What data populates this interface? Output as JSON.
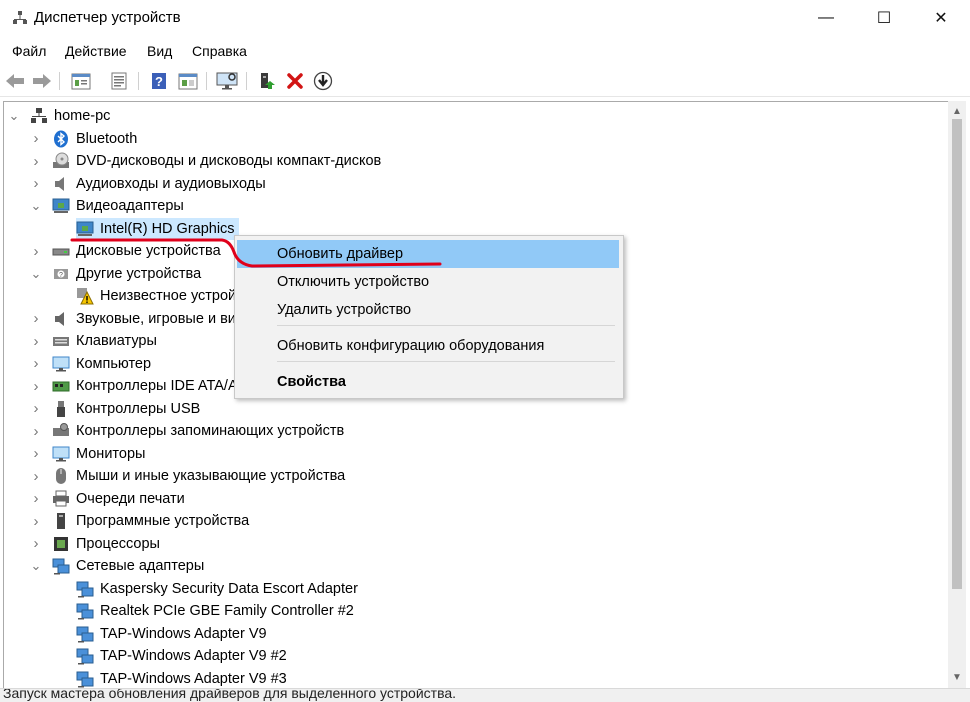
{
  "window": {
    "title": "Диспетчер устройств",
    "min": "—",
    "max": "☐",
    "close": "✕"
  },
  "menu": [
    "Файл",
    "Действие",
    "Вид",
    "Справка"
  ],
  "toolbar": [
    "back-icon",
    "forward-icon",
    "properties-icon",
    "list-icon",
    "help-icon",
    "details-icon",
    "monitor-icon",
    "update-driver-icon",
    "remove-icon",
    "download-icon"
  ],
  "tree": [
    {
      "level": 0,
      "label": "home-pc",
      "expanded": true,
      "icon": "computer-icon"
    },
    {
      "level": 1,
      "label": "Bluetooth",
      "expanded": false,
      "icon": "bluetooth-icon"
    },
    {
      "level": 1,
      "label": "DVD-дисководы и дисководы компакт-дисков",
      "expanded": false,
      "icon": "dvd-icon"
    },
    {
      "level": 1,
      "label": "Аудиовходы и аудиовыходы",
      "expanded": false,
      "icon": "speaker-icon"
    },
    {
      "level": 1,
      "label": "Видеоадаптеры",
      "expanded": true,
      "icon": "display-adapter-icon"
    },
    {
      "level": 2,
      "label": "Intel(R) HD Graphics",
      "icon": "display-adapter-icon",
      "selected": true
    },
    {
      "level": 1,
      "label": "Дисковые устройства",
      "expanded": false,
      "icon": "disk-icon"
    },
    {
      "level": 1,
      "label": "Другие устройства",
      "expanded": true,
      "icon": "other-devices-icon"
    },
    {
      "level": 2,
      "label": "Неизвестное устрой",
      "icon": "warning-device-icon"
    },
    {
      "level": 1,
      "label": "Звуковые, игровые и ви",
      "expanded": false,
      "icon": "sound-icon"
    },
    {
      "level": 1,
      "label": "Клавиатуры",
      "expanded": false,
      "icon": "keyboard-icon"
    },
    {
      "level": 1,
      "label": "Компьютер",
      "expanded": false,
      "icon": "monitor-icon"
    },
    {
      "level": 1,
      "label": "Контроллеры IDE ATA/A",
      "expanded": false,
      "icon": "ide-icon"
    },
    {
      "level": 1,
      "label": "Контроллеры USB",
      "expanded": false,
      "icon": "usb-icon"
    },
    {
      "level": 1,
      "label": "Контроллеры запоминающих устройств",
      "expanded": false,
      "icon": "storage-icon"
    },
    {
      "level": 1,
      "label": "Мониторы",
      "expanded": false,
      "icon": "monitor-icon"
    },
    {
      "level": 1,
      "label": "Мыши и иные указывающие устройства",
      "expanded": false,
      "icon": "mouse-icon"
    },
    {
      "level": 1,
      "label": "Очереди печати",
      "expanded": false,
      "icon": "printer-icon"
    },
    {
      "level": 1,
      "label": "Программные устройства",
      "expanded": false,
      "icon": "software-device-icon"
    },
    {
      "level": 1,
      "label": "Процессоры",
      "expanded": false,
      "icon": "cpu-icon"
    },
    {
      "level": 1,
      "label": "Сетевые адаптеры",
      "expanded": true,
      "icon": "network-icon"
    },
    {
      "level": 2,
      "label": "Kaspersky Security Data Escort Adapter",
      "icon": "network-icon"
    },
    {
      "level": 2,
      "label": "Realtek PCIe GBE Family Controller #2",
      "icon": "network-icon"
    },
    {
      "level": 2,
      "label": "TAP-Windows Adapter V9",
      "icon": "network-icon"
    },
    {
      "level": 2,
      "label": "TAP-Windows Adapter V9 #2",
      "icon": "network-icon"
    },
    {
      "level": 2,
      "label": "TAP-Windows Adapter V9 #3",
      "icon": "network-icon"
    }
  ],
  "context_menu": {
    "update_driver": "Обновить драйвер",
    "disable_device": "Отключить устройство",
    "uninstall_device": "Удалить устройство",
    "scan_hardware": "Обновить конфигурацию оборудования",
    "properties": "Свойства"
  },
  "status_bar": "Запуск мастера обновления драйверов для выделенного устройства.",
  "colors": {
    "selection": "#cce8ff",
    "menu_highlight": "#91c9f7",
    "annotation": "#e0001b"
  }
}
